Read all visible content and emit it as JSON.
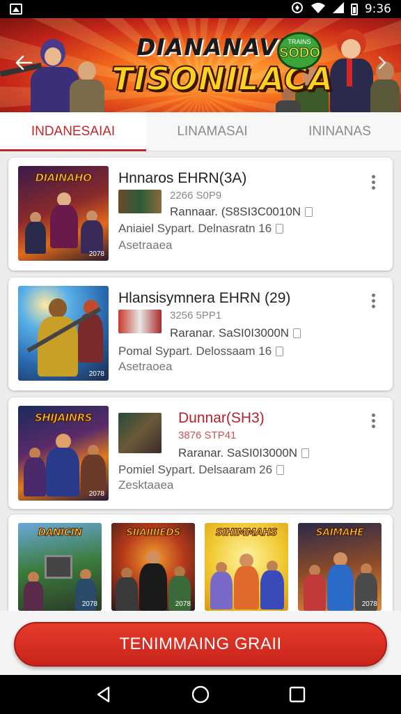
{
  "status_bar": {
    "time": "9:36",
    "icons": [
      "gallery-icon",
      "data-saver-icon",
      "wifi-icon",
      "signal-icon",
      "battery-icon"
    ]
  },
  "banner": {
    "title_top": "DIANANAVI",
    "title_main": "TISONILACA",
    "badge_small": "TRAINS",
    "badge_big": "SODO",
    "back_icon": "back-arrow-icon",
    "next_icon": "chevron-right-icon"
  },
  "tabs": [
    {
      "label": "INDANESAIAI",
      "active": true
    },
    {
      "label": "LINAMASAI",
      "active": false
    },
    {
      "label": "ININANAS",
      "active": false
    }
  ],
  "cards": [
    {
      "thumb_title": "DIAINAHO",
      "thumb_year": "2078",
      "title": "Hnnaros EHRN(3A)",
      "meta1": "2266 S0P9",
      "meta2": "Rannaar. (S8SI3C0010N",
      "meta3": "Aniaiel Sypart.  Delnasratn 16",
      "meta4": "Asetraaea"
    },
    {
      "thumb_title": "",
      "thumb_year": "2078",
      "title": "Hlansisymnera EHRN (29)",
      "meta1": "3256 5PP1",
      "meta2": "Raranar.  SaSI0I3000N",
      "meta3": "Pomal Sypart.  Delossaam 16",
      "meta4": "Asetraoea"
    },
    {
      "thumb_title": "SHIJAINRS",
      "thumb_year": "2078",
      "title": "Dunnar(SH3)",
      "meta1": "3876 STP41",
      "meta2": "Raranar.  SaSI0I3000N",
      "meta3": "Pomiel Sypart.  Delsaaram 26",
      "meta4": "Zesktaaea"
    }
  ],
  "grid_items": [
    {
      "title": "DANICIN",
      "year": "2078"
    },
    {
      "title": "SIIAIIIIEDS",
      "year": "2078"
    },
    {
      "title": "SIHIMMAHS",
      "year": ""
    },
    {
      "title": "SAIMAHE",
      "year": "2078"
    }
  ],
  "cta": {
    "label": "TENIMMAING GRAII"
  },
  "nav": {
    "back_icon": "nav-back-icon",
    "home_icon": "nav-home-icon",
    "recents_icon": "nav-recents-icon"
  },
  "colors": {
    "accent": "#c0262a",
    "cta": "#d83022",
    "title_yellow": "#ffcc2a"
  }
}
